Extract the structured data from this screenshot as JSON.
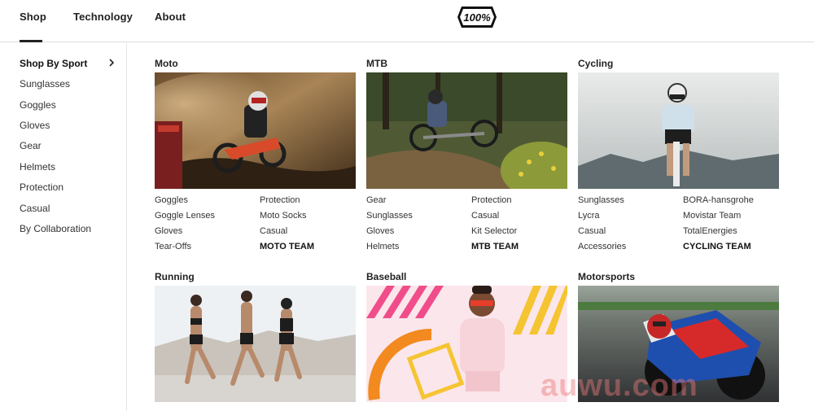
{
  "topnav": {
    "items": [
      "Shop",
      "Technology",
      "About"
    ],
    "brand": "100%"
  },
  "sidebar": {
    "items": [
      "Shop By Sport",
      "Sunglasses",
      "Goggles",
      "Gloves",
      "Gear",
      "Helmets",
      "Protection",
      "Casual",
      "By Collaboration"
    ]
  },
  "sports": [
    {
      "title": "Moto",
      "image": "motocross-rider-photo",
      "links": [
        "Goggles",
        "Goggle Lenses",
        "Gloves",
        "Tear-Offs",
        "Protection",
        "Moto Socks",
        "Casual",
        "MOTO TEAM"
      ]
    },
    {
      "title": "MTB",
      "image": "mountain-bike-rider-photo",
      "links": [
        "Gear",
        "Sunglasses",
        "Gloves",
        "Helmets",
        "Protection",
        "Casual",
        "Kit Selector",
        "MTB TEAM"
      ]
    },
    {
      "title": "Cycling",
      "image": "road-cyclist-photo",
      "links": [
        "Sunglasses",
        "Lycra",
        "Casual",
        "Accessories",
        "BORA-hansgrohe",
        "Movistar Team",
        "TotalEnergies",
        "CYCLING TEAM"
      ]
    },
    {
      "title": "Running",
      "image": "runners-photo"
    },
    {
      "title": "Baseball",
      "image": "baseball-player-photo"
    },
    {
      "title": "Motorsports",
      "image": "motogp-racer-photo"
    }
  ],
  "watermark": "auwu.com"
}
